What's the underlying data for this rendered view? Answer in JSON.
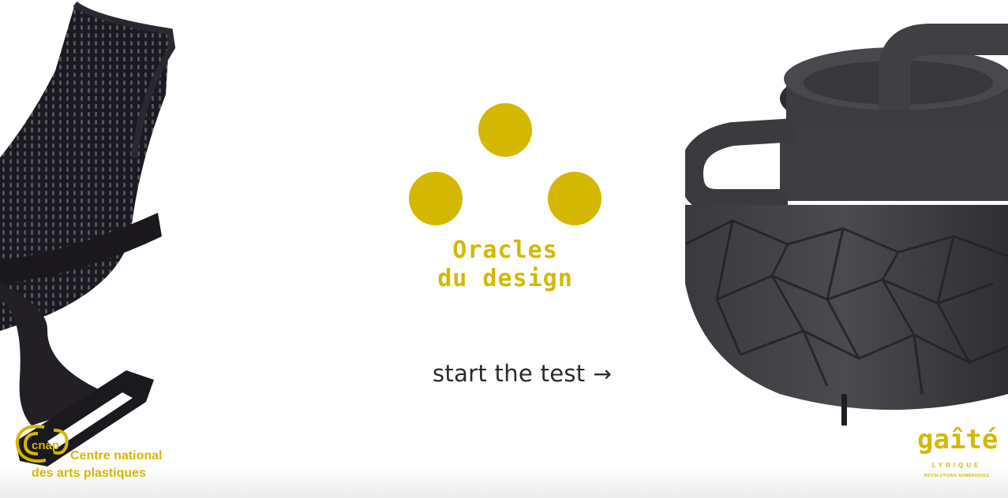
{
  "title": {
    "line1": "Oracles",
    "line2": "du design"
  },
  "cta": {
    "label": "start the test",
    "arrow": "→"
  },
  "partners": {
    "cnap": {
      "logo_text": "cnap",
      "line1": "Centre national",
      "line2": "des arts plastiques"
    },
    "gaite": {
      "logo_text": "gaîté",
      "line1": "LYRIQUE",
      "line2": "RÉVOLUTIONS NUMÉRIQUES"
    }
  },
  "colors": {
    "accent": "#d4b800",
    "text": "#2a2a2a",
    "product_dark": "#2c2c30"
  },
  "icons": {
    "cta_arrow": "right-arrow-icon",
    "logo": "three-dots-logo"
  }
}
